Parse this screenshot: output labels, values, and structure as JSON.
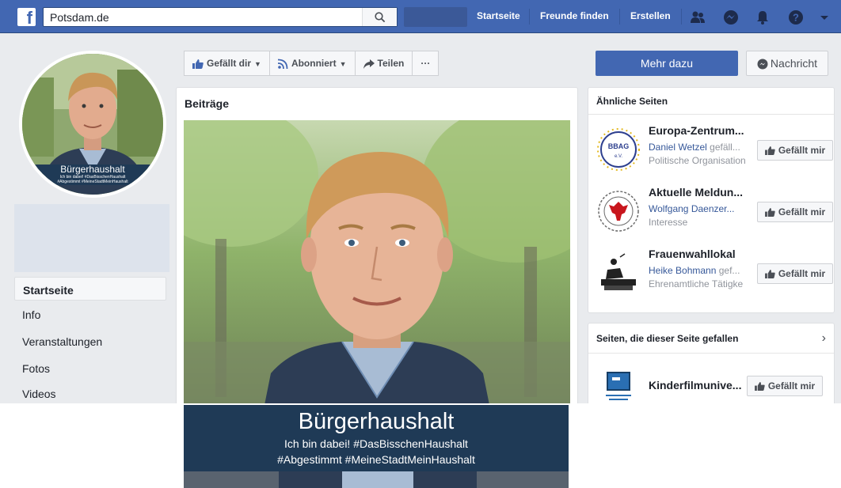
{
  "topbar": {
    "search_value": "Potsdam.de",
    "nav": [
      "Startseite",
      "Freunde finden",
      "Erstellen"
    ],
    "icons": [
      "friends-icon",
      "messenger-icon",
      "notifications-icon",
      "help-icon",
      "caret-down-icon"
    ]
  },
  "profile": {
    "banner_title": "Bürgerhaushalt",
    "banner_sub1": "Ich bin dabei! #DasBisschenHaushalt",
    "banner_sub2": "#Abgestimmt #MeineStadtMeinHaushalt"
  },
  "left_nav": [
    "Startseite",
    "Info",
    "Veranstaltungen",
    "Fotos",
    "Videos"
  ],
  "action_bar": {
    "like": "Gefällt dir",
    "follow": "Abonniert",
    "share": "Teilen",
    "more": "···"
  },
  "cta": {
    "primary": "Mehr dazu",
    "message": "Nachricht"
  },
  "posts": {
    "title": "Beiträge"
  },
  "similar_pages": {
    "title": "Ähnliche Seiten",
    "items": [
      {
        "name": "Europa-Zentrum...",
        "friend": "Daniel Wetzel",
        "friend_rest": " gefäll...",
        "category": "Politische Organisation",
        "button": "Gefällt mir",
        "thumb_text": "BBAG"
      },
      {
        "name": "Aktuelle Meldun...",
        "friend": "Wolfgang Daenzer...",
        "friend_rest": "",
        "category": "Interesse",
        "button": "Gefällt mir"
      },
      {
        "name": "Frauenwahllokal",
        "friend": "Heike Bohmann",
        "friend_rest": " gef...",
        "category": "Ehrenamtliche Tätigke",
        "button": "Gefällt mir"
      }
    ]
  },
  "liked_pages": {
    "title": "Seiten, die dieser Seite gefallen",
    "chevron": "›",
    "items": [
      {
        "name": "Kinderfilmunive...",
        "button": "Gefällt mir"
      }
    ]
  },
  "overlay": {
    "title": "Bürgerhaushalt",
    "line1": "Ich bin dabei! #DasBisschenHaushalt",
    "line2": "#Abgestimmt #MeineStadtMeinHaushalt"
  },
  "colors": {
    "brand_blue": "#4267b2",
    "banner_navy": "#1f3a56",
    "page_bg": "#e9ebee"
  }
}
